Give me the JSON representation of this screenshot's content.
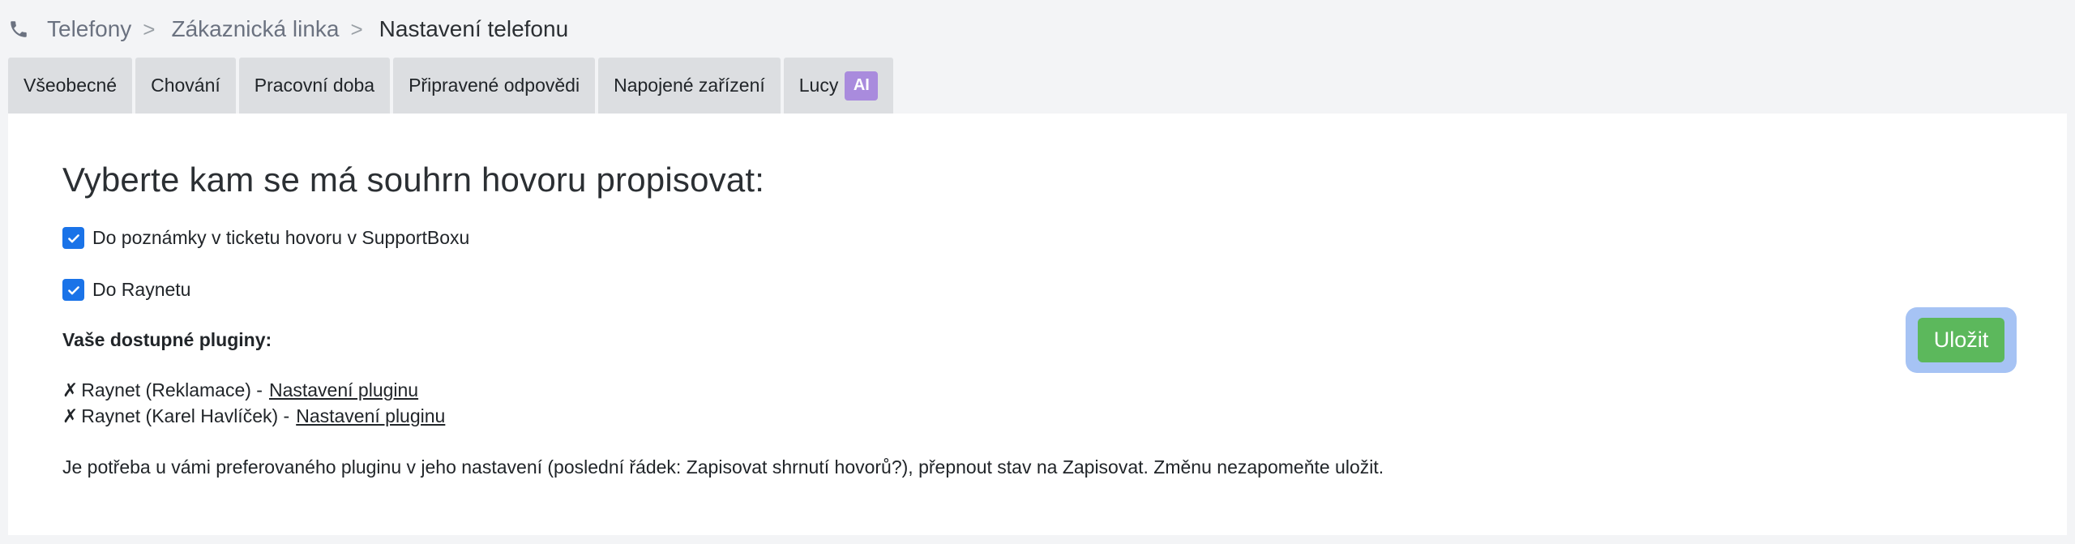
{
  "breadcrumb": {
    "items": [
      "Telefony",
      "Zákaznická linka",
      "Nastavení telefonu"
    ],
    "separator": ">"
  },
  "tabs": [
    {
      "label": "Všeobecné"
    },
    {
      "label": "Chování"
    },
    {
      "label": "Pracovní doba"
    },
    {
      "label": "Připravené odpovědi"
    },
    {
      "label": "Napojené zařízení"
    },
    {
      "label": "Lucy",
      "badge": "AI"
    }
  ],
  "main": {
    "heading": "Vyberte kam se má souhrn hovoru propisovat:",
    "options": [
      {
        "label": "Do poznámky v ticketu hovoru v SupportBoxu",
        "checked": true
      },
      {
        "label": "Do Raynetu",
        "checked": true
      }
    ],
    "plugins_title": "Vaše dostupné pluginy:",
    "plugins": [
      {
        "mark": "✗",
        "name": "Raynet (Reklamace) -",
        "link": "Nastavení pluginu"
      },
      {
        "mark": "✗",
        "name": "Raynet (Karel Havlíček) -",
        "link": "Nastavení pluginu"
      }
    ],
    "note": "Je potřeba u vámi preferovaného pluginu v jeho nastavení (poslední řádek: Zapisovat shrnutí hovorů?), přepnout stav na Zapisovat. Změnu nezapomeňte uložit.",
    "save_label": "Uložit"
  },
  "colors": {
    "checkbox": "#1a73e8",
    "ai_badge": "#a98bdd",
    "save_button": "#5cb85c",
    "save_focus_ring": "#a6c3f4"
  },
  "icons": {
    "breadcrumb": "phone-icon",
    "checkbox": "check-icon"
  }
}
